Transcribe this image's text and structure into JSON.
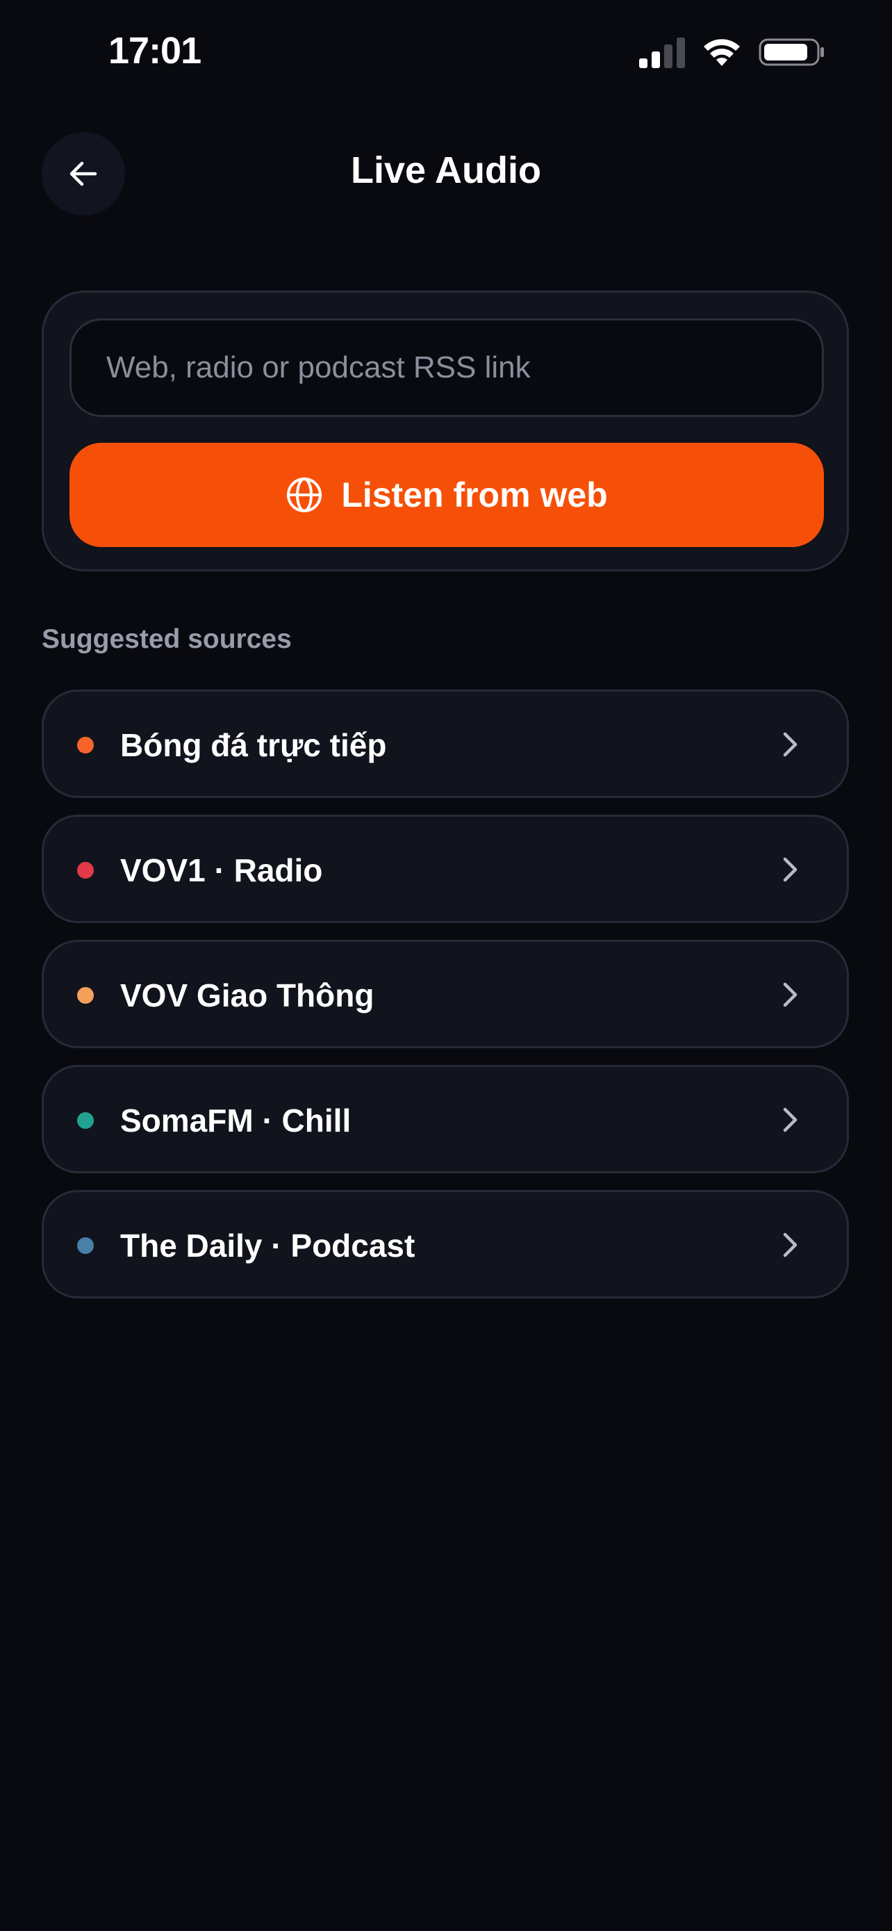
{
  "status_bar": {
    "time": "17:01"
  },
  "header": {
    "title": "Live Audio",
    "back_icon": "arrow-left-icon"
  },
  "input_card": {
    "url_placeholder": "Web, radio or podcast RSS link",
    "url_value": "",
    "listen_button_label": "Listen from web",
    "listen_button_icon": "globe-icon"
  },
  "suggested": {
    "heading": "Suggested sources",
    "items": [
      {
        "label": "Bóng đá trực tiếp",
        "dot_color": "#f6642c"
      },
      {
        "label": "VOV1 · Radio",
        "dot_color": "#e23a4a"
      },
      {
        "label": "VOV Giao Thông",
        "dot_color": "#f2a05a"
      },
      {
        "label": "SomaFM · Chill",
        "dot_color": "#22a391"
      },
      {
        "label": "The Daily · Podcast",
        "dot_color": "#4a7fa8"
      }
    ]
  },
  "colors": {
    "background": "#090a0f",
    "card": "#11131d",
    "accent": "#f65008",
    "muted_text": "#9a9cab"
  }
}
